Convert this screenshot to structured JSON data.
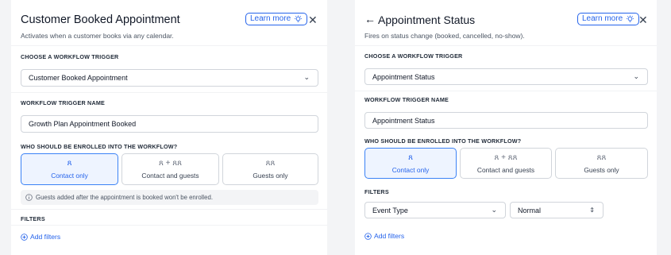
{
  "left": {
    "title": "Customer Booked Appointment",
    "subtitle": "Activates when a customer books via any calendar.",
    "learn_more": "Learn more",
    "close": "✕",
    "trigger_section": "CHOOSE A WORKFLOW TRIGGER",
    "trigger_value": "Customer Booked Appointment",
    "name_section": "WORKFLOW TRIGGER NAME",
    "name_value": "Growth Plan Appointment Booked",
    "enroll_section": "WHO SHOULD BE ENROLLED INTO THE WORKFLOW?",
    "options": [
      {
        "label": "Contact only",
        "icon": "person-icon",
        "selected": true
      },
      {
        "label": "Contact and guests",
        "icon": "person-plus-group-icon",
        "selected": false
      },
      {
        "label": "Guests only",
        "icon": "group-icon",
        "selected": false
      }
    ],
    "info_note": "Guests added after the appointment is booked won't be enrolled.",
    "filters_section": "FILTERS",
    "add_filters": "Add filters"
  },
  "right": {
    "back": "←",
    "title": "Appointment Status",
    "subtitle": "Fires on status change (booked, cancelled, no-show).",
    "learn_more": "Learn more",
    "close": "✕",
    "trigger_section": "CHOOSE A WORKFLOW TRIGGER",
    "trigger_value": "Appointment Status",
    "name_section": "WORKFLOW TRIGGER NAME",
    "name_value": "Appointment Status",
    "enroll_section": "WHO SHOULD BE ENROLLED INTO THE WORKFLOW?",
    "options": [
      {
        "label": "Contact only",
        "icon": "person-icon",
        "selected": true
      },
      {
        "label": "Contact and guests",
        "icon": "person-plus-group-icon",
        "selected": false
      },
      {
        "label": "Guests only",
        "icon": "group-icon",
        "selected": false
      }
    ],
    "filters_section": "FILTERS",
    "filter_field": "Event Type",
    "filter_value": "Normal",
    "add_filters": "Add filters"
  },
  "colors": {
    "accent": "#2563eb",
    "selected_bg": "#eef4ff",
    "border": "#d1d5db"
  }
}
